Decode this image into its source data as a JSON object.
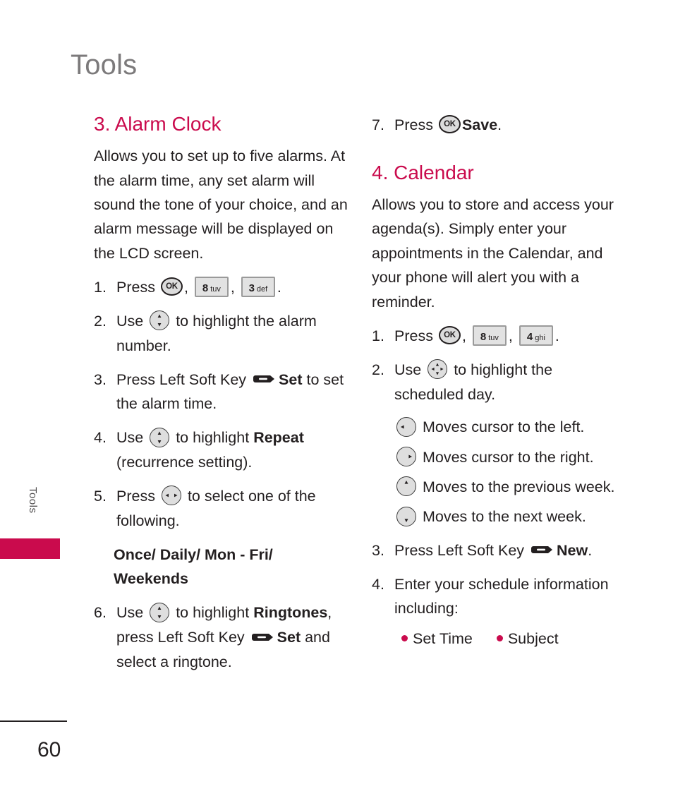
{
  "chapter": {
    "title": "Tools"
  },
  "side_tab": {
    "label": "Tools",
    "color": "#ca0b4d"
  },
  "footer": {
    "page_number": "60"
  },
  "colors": {
    "accent": "#ca0b4d",
    "heading_gray": "#7c7a7b",
    "body": "#231f20"
  },
  "left_column": {
    "heading": "3. Alarm Clock",
    "intro": "Allows you to set up to five alarms. At the alarm time, any set alarm will sound the tone of your choice, and an alarm message will be displayed on the LCD screen.",
    "steps": {
      "s1_num": "1.",
      "s1_press": "Press",
      "s1_ok": "OK",
      "s1_comma1": ",",
      "s1_key1_num": "8",
      "s1_key1_letters": "tuv",
      "s1_comma2": ",",
      "s1_key2_num": "3",
      "s1_key2_letters": "def",
      "s1_period": ".",
      "s2_num": "2.",
      "s2_use": "Use",
      "s2_text": "to highlight the alarm number.",
      "s3_num": "3.",
      "s3_press": "Press Left Soft Key",
      "s3_bold": "Set",
      "s3_tail": "to set the alarm time.",
      "s4_num": "4.",
      "s4_use": "Use",
      "s4_text": "to highlight",
      "s4_bold": "Repeat",
      "s4_tail": "(recurrence setting).",
      "s5_num": "5.",
      "s5_press": "Press",
      "s5_text": "to select one of the following.",
      "options": "Once/ Daily/ Mon - Fri/ Weekends",
      "s6_num": "6.",
      "s6_use": "Use",
      "s6_text": "to highlight",
      "s6_bold1": "Ringtones",
      "s6_mid": ", press Left Soft Key",
      "s6_bold2": "Set",
      "s6_tail": "and select a ringtone."
    }
  },
  "right_column": {
    "step7": {
      "num": "7.",
      "press": "Press",
      "ok": "OK",
      "bold": "Save",
      "period": "."
    },
    "heading": "4. Calendar",
    "intro": "Allows you to store and access your agenda(s). Simply enter your appointments in the Calendar, and your phone will alert you with a reminder.",
    "steps": {
      "s1_num": "1.",
      "s1_press": "Press",
      "s1_ok": "OK",
      "s1_comma1": ",",
      "s1_key1_num": "8",
      "s1_key1_letters": "tuv",
      "s1_comma2": ",",
      "s1_key2_num": "4",
      "s1_key2_letters": "ghi",
      "s1_period": ".",
      "s2_num": "2.",
      "s2_use": "Use",
      "s2_text": "to highlight the scheduled day.",
      "nav_left": "Moves cursor to the left.",
      "nav_right": "Moves cursor to the right.",
      "nav_up": "Moves to the previous week.",
      "nav_down": "Moves to the next week.",
      "s3_num": "3.",
      "s3_press": "Press Left Soft Key",
      "s3_bold": "New",
      "s3_period": ".",
      "s4_num": "4.",
      "s4_text": "Enter your schedule information including:",
      "bullets": [
        "Set Time",
        "Subject"
      ]
    }
  }
}
